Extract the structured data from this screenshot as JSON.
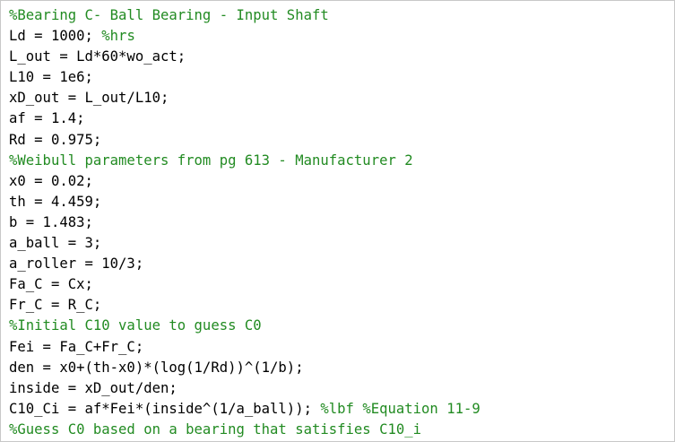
{
  "editor": {
    "lines": [
      {
        "code": "",
        "comment": "%Bearing C- Ball Bearing - Input Shaft"
      },
      {
        "code": "Ld = 1000; ",
        "comment": "%hrs"
      },
      {
        "code": "L_out = Ld*60*wo_act;",
        "comment": ""
      },
      {
        "code": "L10 = 1e6;",
        "comment": ""
      },
      {
        "code": "xD_out = L_out/L10;",
        "comment": ""
      },
      {
        "code": "af = 1.4;",
        "comment": ""
      },
      {
        "code": "Rd = 0.975;",
        "comment": ""
      },
      {
        "code": "",
        "comment": "%Weibull parameters from pg 613 - Manufacturer 2"
      },
      {
        "code": "x0 = 0.02;",
        "comment": ""
      },
      {
        "code": "th = 4.459;",
        "comment": ""
      },
      {
        "code": "b = 1.483;",
        "comment": ""
      },
      {
        "code": "a_ball = 3;",
        "comment": ""
      },
      {
        "code": "a_roller = 10/3;",
        "comment": ""
      },
      {
        "code": "Fa_C = Cx;",
        "comment": ""
      },
      {
        "code": "Fr_C = R_C;",
        "comment": ""
      },
      {
        "code": "",
        "comment": "%Initial C10 value to guess C0"
      },
      {
        "code": "Fei = Fa_C+Fr_C;",
        "comment": ""
      },
      {
        "code": "den = x0+(th-x0)*(log(1/Rd))^(1/b);",
        "comment": ""
      },
      {
        "code": "inside = xD_out/den;",
        "comment": ""
      },
      {
        "code": "C10_Ci = af*Fei*(inside^(1/a_ball)); ",
        "comment": "%lbf %Equation 11-9"
      },
      {
        "code": "",
        "comment": "%Guess C0 based on a bearing that satisfies C10_i"
      }
    ]
  },
  "colors": {
    "comment": "#228b22",
    "code": "#000000",
    "background": "#ffffff"
  }
}
